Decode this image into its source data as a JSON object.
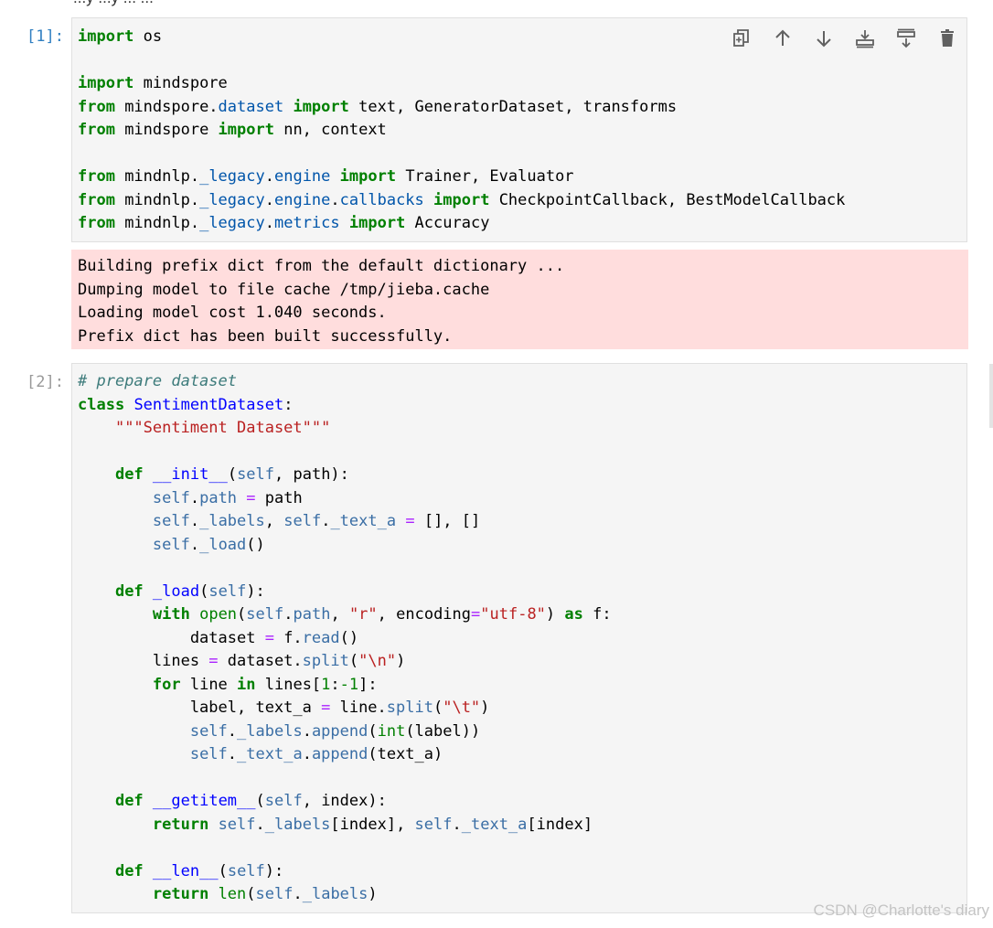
{
  "top_partial_text": "...y ...y ... ...",
  "cells": [
    {
      "prompt": "[1]:",
      "lines": [
        [
          {
            "t": "import",
            "c": "kw"
          },
          {
            "t": " os"
          }
        ],
        [],
        [
          {
            "t": "import",
            "c": "kw"
          },
          {
            "t": " mindspore"
          }
        ],
        [
          {
            "t": "from",
            "c": "kw"
          },
          {
            "t": " mindspore."
          },
          {
            "t": "dataset",
            "c": "mod"
          },
          {
            "t": " "
          },
          {
            "t": "import",
            "c": "kw"
          },
          {
            "t": " text, GeneratorDataset, transforms"
          }
        ],
        [
          {
            "t": "from",
            "c": "kw"
          },
          {
            "t": " mindspore "
          },
          {
            "t": "import",
            "c": "kw"
          },
          {
            "t": " nn, context"
          }
        ],
        [],
        [
          {
            "t": "from",
            "c": "kw"
          },
          {
            "t": " mindnlp."
          },
          {
            "t": "_legacy",
            "c": "mod"
          },
          {
            "t": "."
          },
          {
            "t": "engine",
            "c": "mod"
          },
          {
            "t": " "
          },
          {
            "t": "import",
            "c": "kw"
          },
          {
            "t": " Trainer, Evaluator"
          }
        ],
        [
          {
            "t": "from",
            "c": "kw"
          },
          {
            "t": " mindnlp."
          },
          {
            "t": "_legacy",
            "c": "mod"
          },
          {
            "t": "."
          },
          {
            "t": "engine",
            "c": "mod"
          },
          {
            "t": "."
          },
          {
            "t": "callbacks",
            "c": "mod"
          },
          {
            "t": " "
          },
          {
            "t": "import",
            "c": "kw"
          },
          {
            "t": " CheckpointCallback, BestModelCallback"
          }
        ],
        [
          {
            "t": "from",
            "c": "kw"
          },
          {
            "t": " mindnlp."
          },
          {
            "t": "_legacy",
            "c": "mod"
          },
          {
            "t": "."
          },
          {
            "t": "metrics",
            "c": "mod"
          },
          {
            "t": " "
          },
          {
            "t": "import",
            "c": "kw"
          },
          {
            "t": " Accuracy"
          }
        ]
      ],
      "stderr": [
        "Building prefix dict from the default dictionary ...",
        "Dumping model to file cache /tmp/jieba.cache",
        "Loading model cost 1.040 seconds.",
        "Prefix dict has been built successfully."
      ]
    },
    {
      "prompt": "[2]:",
      "lines": [
        [
          {
            "t": "# prepare dataset",
            "c": "cm"
          }
        ],
        [
          {
            "t": "class",
            "c": "kw"
          },
          {
            "t": " "
          },
          {
            "t": "SentimentDataset",
            "c": "cls"
          },
          {
            "t": ":"
          }
        ],
        [
          {
            "t": "    "
          },
          {
            "t": "\"\"\"Sentiment Dataset\"\"\"",
            "c": "st"
          }
        ],
        [],
        [
          {
            "t": "    "
          },
          {
            "t": "def",
            "c": "kw"
          },
          {
            "t": " "
          },
          {
            "t": "__init__",
            "c": "fn"
          },
          {
            "t": "("
          },
          {
            "t": "self",
            "c": "sf"
          },
          {
            "t": ", path):"
          }
        ],
        [
          {
            "t": "        "
          },
          {
            "t": "self",
            "c": "sf"
          },
          {
            "t": "."
          },
          {
            "t": "path",
            "c": "sf"
          },
          {
            "t": " "
          },
          {
            "t": "=",
            "c": "op"
          },
          {
            "t": " path"
          }
        ],
        [
          {
            "t": "        "
          },
          {
            "t": "self",
            "c": "sf"
          },
          {
            "t": "."
          },
          {
            "t": "_labels",
            "c": "sf"
          },
          {
            "t": ", "
          },
          {
            "t": "self",
            "c": "sf"
          },
          {
            "t": "."
          },
          {
            "t": "_text_a",
            "c": "sf"
          },
          {
            "t": " "
          },
          {
            "t": "=",
            "c": "op"
          },
          {
            "t": " [], []"
          }
        ],
        [
          {
            "t": "        "
          },
          {
            "t": "self",
            "c": "sf"
          },
          {
            "t": "."
          },
          {
            "t": "_load",
            "c": "sf"
          },
          {
            "t": "()"
          }
        ],
        [],
        [
          {
            "t": "    "
          },
          {
            "t": "def",
            "c": "kw"
          },
          {
            "t": " "
          },
          {
            "t": "_load",
            "c": "fn"
          },
          {
            "t": "("
          },
          {
            "t": "self",
            "c": "sf"
          },
          {
            "t": "):"
          }
        ],
        [
          {
            "t": "        "
          },
          {
            "t": "with",
            "c": "kw"
          },
          {
            "t": " "
          },
          {
            "t": "open",
            "c": "nb"
          },
          {
            "t": "("
          },
          {
            "t": "self",
            "c": "sf"
          },
          {
            "t": "."
          },
          {
            "t": "path",
            "c": "sf"
          },
          {
            "t": ", "
          },
          {
            "t": "\"r\"",
            "c": "st"
          },
          {
            "t": ", encoding"
          },
          {
            "t": "=",
            "c": "op"
          },
          {
            "t": "\"utf-8\"",
            "c": "st"
          },
          {
            "t": ") "
          },
          {
            "t": "as",
            "c": "kw"
          },
          {
            "t": " f:"
          }
        ],
        [
          {
            "t": "            dataset "
          },
          {
            "t": "=",
            "c": "op"
          },
          {
            "t": " f."
          },
          {
            "t": "read",
            "c": "sf"
          },
          {
            "t": "()"
          }
        ],
        [
          {
            "t": "        lines "
          },
          {
            "t": "=",
            "c": "op"
          },
          {
            "t": " dataset."
          },
          {
            "t": "split",
            "c": "sf"
          },
          {
            "t": "("
          },
          {
            "t": "\"\\n\"",
            "c": "st"
          },
          {
            "t": ")"
          }
        ],
        [
          {
            "t": "        "
          },
          {
            "t": "for",
            "c": "kw"
          },
          {
            "t": " line "
          },
          {
            "t": "in",
            "c": "kw"
          },
          {
            "t": " lines["
          },
          {
            "t": "1",
            "c": "nb"
          },
          {
            "t": ":"
          },
          {
            "t": "-1",
            "c": "nb"
          },
          {
            "t": "]:"
          }
        ],
        [
          {
            "t": "            label, text_a "
          },
          {
            "t": "=",
            "c": "op"
          },
          {
            "t": " line."
          },
          {
            "t": "split",
            "c": "sf"
          },
          {
            "t": "("
          },
          {
            "t": "\"\\t\"",
            "c": "st"
          },
          {
            "t": ")"
          }
        ],
        [
          {
            "t": "            "
          },
          {
            "t": "self",
            "c": "sf"
          },
          {
            "t": "."
          },
          {
            "t": "_labels",
            "c": "sf"
          },
          {
            "t": "."
          },
          {
            "t": "append",
            "c": "sf"
          },
          {
            "t": "("
          },
          {
            "t": "int",
            "c": "nb"
          },
          {
            "t": "(label))"
          }
        ],
        [
          {
            "t": "            "
          },
          {
            "t": "self",
            "c": "sf"
          },
          {
            "t": "."
          },
          {
            "t": "_text_a",
            "c": "sf"
          },
          {
            "t": "."
          },
          {
            "t": "append",
            "c": "sf"
          },
          {
            "t": "(text_a)"
          }
        ],
        [],
        [
          {
            "t": "    "
          },
          {
            "t": "def",
            "c": "kw"
          },
          {
            "t": " "
          },
          {
            "t": "__getitem__",
            "c": "fn"
          },
          {
            "t": "("
          },
          {
            "t": "self",
            "c": "sf"
          },
          {
            "t": ", index):"
          }
        ],
        [
          {
            "t": "        "
          },
          {
            "t": "return",
            "c": "kw"
          },
          {
            "t": " "
          },
          {
            "t": "self",
            "c": "sf"
          },
          {
            "t": "."
          },
          {
            "t": "_labels",
            "c": "sf"
          },
          {
            "t": "[index], "
          },
          {
            "t": "self",
            "c": "sf"
          },
          {
            "t": "."
          },
          {
            "t": "_text_a",
            "c": "sf"
          },
          {
            "t": "[index]"
          }
        ],
        [],
        [
          {
            "t": "    "
          },
          {
            "t": "def",
            "c": "kw"
          },
          {
            "t": " "
          },
          {
            "t": "__len__",
            "c": "fn"
          },
          {
            "t": "("
          },
          {
            "t": "self",
            "c": "sf"
          },
          {
            "t": "):"
          }
        ],
        [
          {
            "t": "        "
          },
          {
            "t": "return",
            "c": "kw"
          },
          {
            "t": " "
          },
          {
            "t": "len",
            "c": "nb"
          },
          {
            "t": "("
          },
          {
            "t": "self",
            "c": "sf"
          },
          {
            "t": "."
          },
          {
            "t": "_labels",
            "c": "sf"
          },
          {
            "t": ")"
          }
        ]
      ]
    }
  ],
  "toolbar": [
    {
      "name": "duplicate-cell-icon"
    },
    {
      "name": "move-up-icon"
    },
    {
      "name": "move-down-icon"
    },
    {
      "name": "insert-above-icon"
    },
    {
      "name": "insert-below-icon"
    },
    {
      "name": "delete-cell-icon"
    }
  ],
  "watermark": "CSDN @Charlotte's diary",
  "colors": {
    "prompt_active": "#307fc1",
    "prompt_idle": "#999999",
    "cell_bg": "#f5f5f5",
    "stderr_bg": "#ffdddd",
    "keyword": "#008000",
    "string": "#ba2121",
    "comment": "#3d7b7b"
  }
}
